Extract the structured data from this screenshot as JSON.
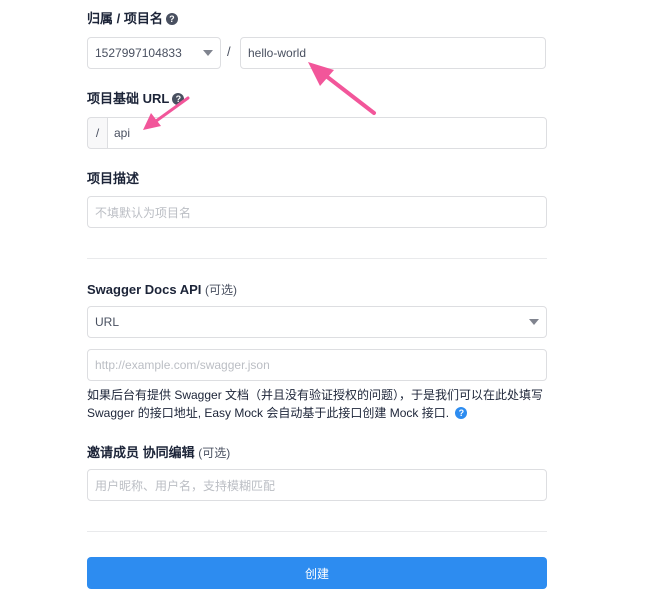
{
  "form": {
    "owner_project": {
      "label": "归属 / 项目名",
      "owner_value": "1527997104833",
      "separator": "/",
      "project_value": "hello-world"
    },
    "base_url": {
      "label": "项目基础 URL",
      "prefix": "/",
      "value": "api"
    },
    "description": {
      "label": "项目描述",
      "placeholder": "不填默认为项目名"
    },
    "swagger": {
      "label": "Swagger Docs API",
      "optional": "(可选)",
      "type_value": "URL",
      "url_placeholder": "http://example.com/swagger.json",
      "hint_line1": "如果后台有提供 Swagger 文档（并且没有验证授权的问题），于是我们可以在此处填写",
      "hint_line2": "Swagger 的接口地址, Easy Mock 会自动基于此接口创建 Mock 接口."
    },
    "members": {
      "label": "邀请成员 协同编辑",
      "optional": "(可选)",
      "placeholder": "用户昵称、用户名，支持模糊匹配"
    },
    "submit_label": "创建"
  },
  "colors": {
    "accent": "#2d8cf0",
    "annotation_arrow": "#f2569a"
  },
  "icons": {
    "help": "question-circle-icon",
    "select_caret": "caret-down-icon"
  }
}
